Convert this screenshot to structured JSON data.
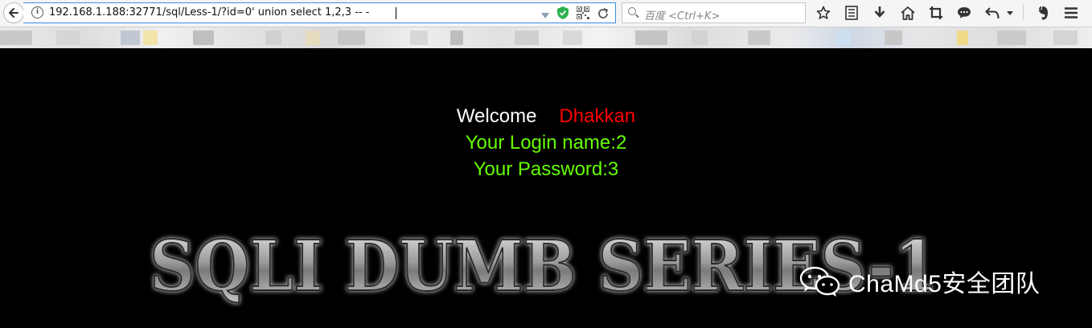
{
  "browser": {
    "url": "192.168.1.188:32771/sql/Less-1/?id=0' union select 1,2,3 -- -",
    "search_placeholder": "百度 <Ctrl+K>",
    "toolbar_icons": [
      "star-icon",
      "reading-list-icon",
      "download-icon",
      "home-icon",
      "screenshot-icon",
      "chat-icon",
      "undo-icon",
      "dropdown-icon",
      "evernote-icon",
      "menu-icon"
    ]
  },
  "page": {
    "welcome_label": "Welcome",
    "user_name": "Dhakkan",
    "login_name": "Your Login name:2",
    "password": "Your Password:3",
    "banner_title": "SQLI DUMB SERIES-1",
    "watermark": "ChaMd5安全团队"
  },
  "colors": {
    "welcome": "#ffffff",
    "user_name": "#ff0000",
    "info": "#66ff00",
    "background": "#000000"
  }
}
